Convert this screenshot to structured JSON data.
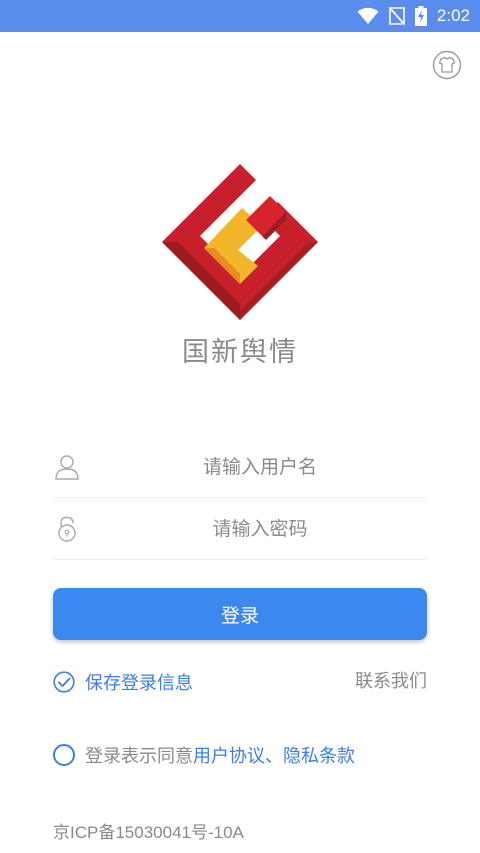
{
  "status_bar": {
    "time": "2:02",
    "icons": [
      "wifi-icon",
      "no-sim-icon",
      "battery-charging-icon"
    ],
    "background": "#5b8def"
  },
  "header": {
    "skin_icon": "tshirt-icon"
  },
  "brand": {
    "app_name": "国新舆情",
    "logo": "gx-logo",
    "colors": {
      "red": "#c8202a",
      "dark_red": "#9c1c22",
      "yellow": "#f3b52a",
      "orange": "#e98a23"
    }
  },
  "login_form": {
    "username_placeholder": "请输入用户名",
    "password_placeholder": "请输入密码",
    "username_icon": "user-icon",
    "password_icon": "lock-icon",
    "login_label": "登录",
    "accent": "#3b88ef"
  },
  "options": {
    "remember_label": "保存登录信息",
    "remember_checked": true,
    "contact_label": "联系我们"
  },
  "agreement": {
    "prefix": "登录表示同意",
    "links": "用户协议、隐私条款",
    "checked": false
  },
  "footer": {
    "icp": "京ICP备15030041号-10A"
  }
}
